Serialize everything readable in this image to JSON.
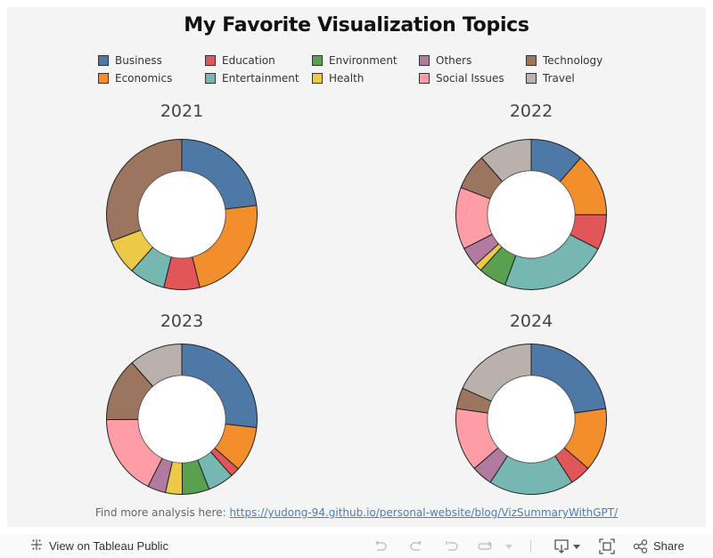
{
  "title": "My Favorite Visualization Topics",
  "footer": {
    "note_prefix": "Find more analysis here: ",
    "link_text": "https://yudong-94.github.io/personal-website/blog/VizSummaryWithGPT/"
  },
  "toolbar": {
    "view_on_label": "View on Tableau Public",
    "share_label": "Share",
    "icons": [
      "tableau-logo-icon",
      "undo-icon",
      "redo-icon",
      "revert-icon",
      "refresh-icon",
      "dropdown-caret-icon",
      "download-icon",
      "fullscreen-icon",
      "share-icon"
    ]
  },
  "chart_data": {
    "type": "pie",
    "variant": "donut",
    "title": "My Favorite Visualization Topics",
    "legend_position": "top",
    "categories": [
      "Business",
      "Education",
      "Environment",
      "Others",
      "Technology",
      "Economics",
      "Entertainment",
      "Health",
      "Social Issues",
      "Travel"
    ],
    "category_order": [
      "Business",
      "Economics",
      "Education",
      "Entertainment",
      "Environment",
      "Health",
      "Others",
      "Social Issues",
      "Technology",
      "Travel"
    ],
    "colors": {
      "Business": "#4E79A7",
      "Economics": "#F28E2B",
      "Education": "#E15759",
      "Entertainment": "#76B7B2",
      "Environment": "#59A14F",
      "Health": "#EDC948",
      "Others": "#B07AA1",
      "Social Issues": "#FF9DA7",
      "Technology": "#9C755F",
      "Travel": "#BAB0AC"
    },
    "unit": "percent share (estimated)",
    "charts": [
      {
        "label": "2021",
        "values": {
          "Business": 23.1,
          "Economics": 23.1,
          "Education": 7.7,
          "Entertainment": 7.7,
          "Environment": 0,
          "Health": 7.7,
          "Others": 0,
          "Social Issues": 0,
          "Technology": 30.8,
          "Travel": 0
        }
      },
      {
        "label": "2022",
        "values": {
          "Business": 11.4,
          "Economics": 13.6,
          "Education": 7.5,
          "Entertainment": 23.0,
          "Environment": 6.0,
          "Health": 1.6,
          "Others": 4.2,
          "Social Issues": 13.3,
          "Technology": 7.7,
          "Travel": 11.4
        }
      },
      {
        "label": "2023",
        "values": {
          "Business": 26.8,
          "Economics": 9.7,
          "Education": 2.0,
          "Entertainment": 5.6,
          "Environment": 5.8,
          "Health": 3.6,
          "Others": 3.9,
          "Social Issues": 17.5,
          "Technology": 13.6,
          "Travel": 11.5
        }
      },
      {
        "label": "2024",
        "values": {
          "Business": 22.7,
          "Economics": 13.6,
          "Education": 4.5,
          "Entertainment": 18.2,
          "Environment": 0,
          "Health": 0,
          "Others": 4.5,
          "Social Issues": 13.6,
          "Technology": 4.5,
          "Travel": 18.2
        }
      }
    ]
  }
}
